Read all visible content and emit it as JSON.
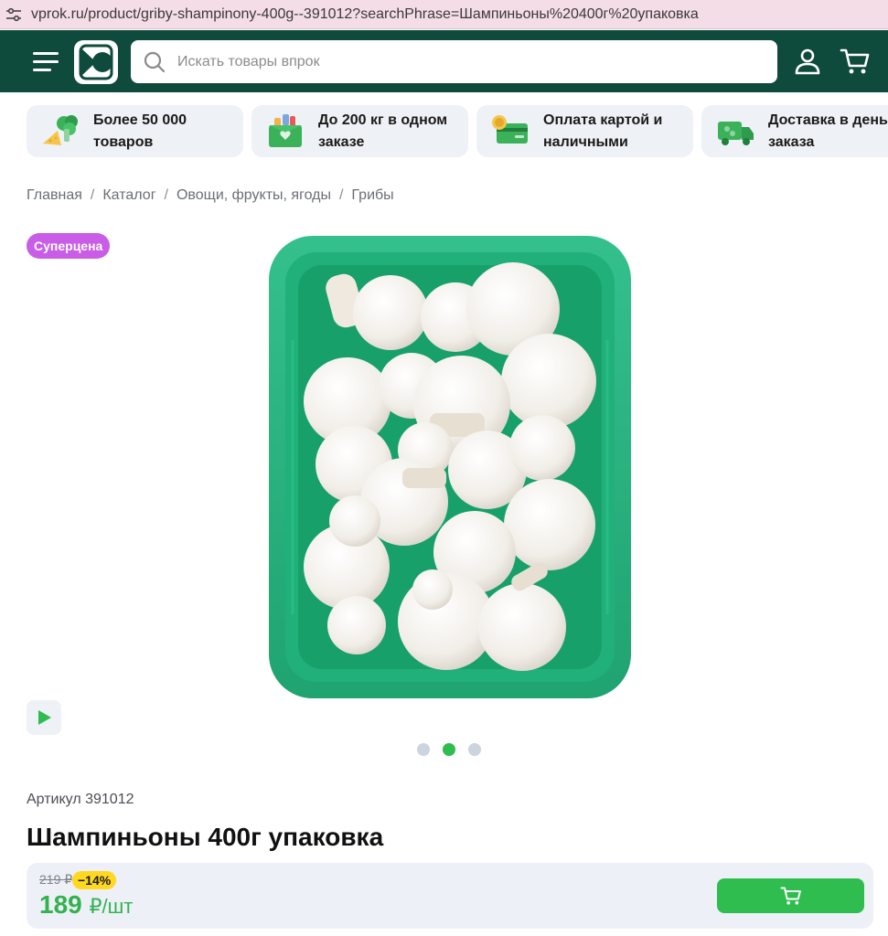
{
  "browser": {
    "url": "vprok.ru/product/griby-shampinony-400g--391012?searchPhrase=Шампиньоны%20400г%20упаковка",
    "tune_icon": "tune-icon"
  },
  "header": {
    "menu_icon": "menu-icon",
    "logo_icon": "vprok-logo-icon",
    "search_placeholder": "Искать товары впрок",
    "search_value": "",
    "user_icon": "user-icon",
    "cart_icon": "cart-icon",
    "background": "#0f4b3d"
  },
  "features": [
    {
      "icon": "broccoli-cheese-icon",
      "line1": "Более 50 000",
      "line2": "товаров"
    },
    {
      "icon": "grocery-box-icon",
      "line1": "До 200 кг в одном",
      "line2": "заказе"
    },
    {
      "icon": "card-coin-icon",
      "line1": "Оплата картой и",
      "line2": "наличными"
    },
    {
      "icon": "delivery-truck-icon",
      "line1": "Доставка в день",
      "line2": "заказа"
    }
  ],
  "breadcrumb": {
    "items": [
      "Главная",
      "Каталог",
      "Овощи, фрукты, ягоды",
      "Грибы"
    ],
    "separator": "/"
  },
  "badge": {
    "label": "Суперцена",
    "color": "#c95de8"
  },
  "gallery": {
    "image_icon": "mushrooms-in-tray-image",
    "play_icon": "play-icon",
    "slides_total": 3,
    "active_slide": 2
  },
  "product": {
    "article": "Артикул 391012",
    "title": "Шампиньоны 400г упаковка"
  },
  "price": {
    "old": "219 ₽",
    "discount": "−14%",
    "current": "189",
    "unit": "₽/шт",
    "accent": "#33b24f",
    "cart_icon": "cart-icon",
    "button_color": "#2ebd4e"
  }
}
